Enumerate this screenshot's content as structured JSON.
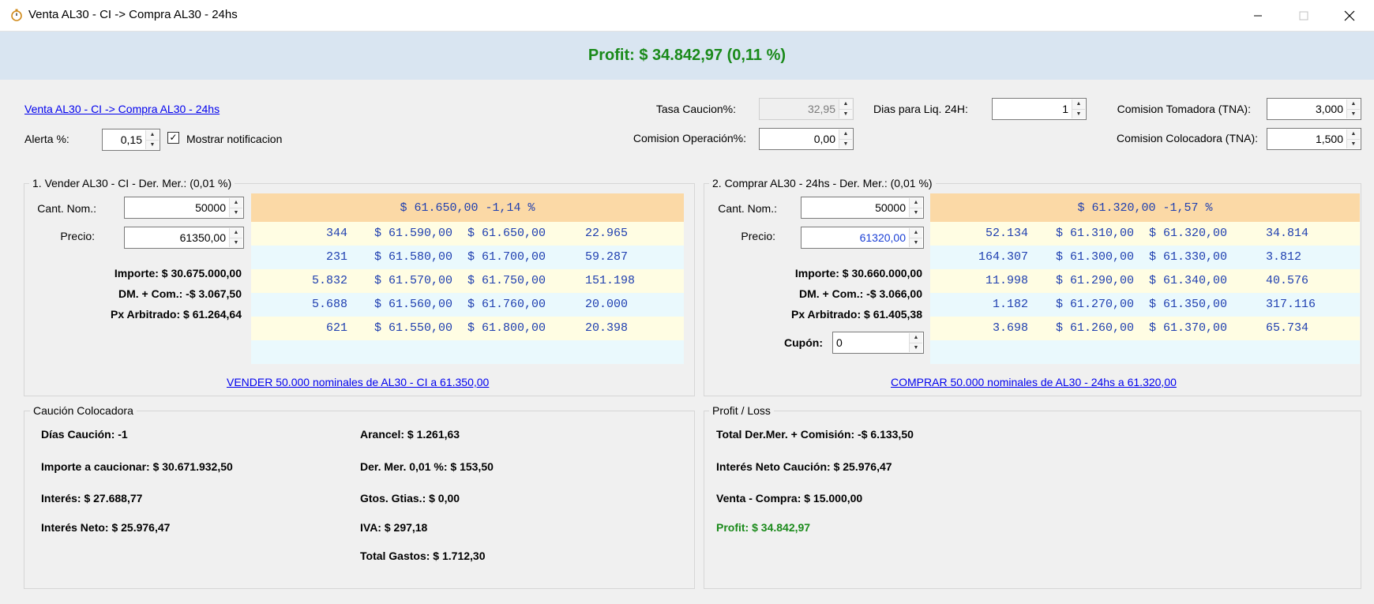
{
  "window": {
    "title": "Venta AL30 - CI -> Compra AL30 - 24hs",
    "icon": "stopwatch-icon",
    "controls": [
      "minimize-icon",
      "maximize-icon",
      "close-icon"
    ]
  },
  "banner": {
    "profit_text": "Profit: $ 34.842,97 (0,11 %)",
    "color": "#1a8a1a"
  },
  "top": {
    "strategy_link": "Venta AL30 - CI -> Compra AL30 - 24hs",
    "alerta_label": "Alerta %:",
    "alerta_value": "0,15",
    "notif_label": "Mostrar notificacion",
    "notif_checked": "✓",
    "tasa_caucion_label": "Tasa Caucion%:",
    "tasa_caucion_value": "32,95",
    "comision_operacion_label": "Comision Operación%:",
    "comision_operacion_value": "0,00",
    "dias_liq_label": "Dias para Liq. 24H:",
    "dias_liq_value": "1",
    "comision_tomadora_label": "Comision Tomadora (TNA):",
    "comision_tomadora_value": "3,000",
    "comision_colocadora_label": "Comision Colocadora (TNA):",
    "comision_colocadora_value": "1,500"
  },
  "sell": {
    "title": "1. Vender AL30 - CI - Der. Mer.: (0,01 %)",
    "cant_label": "Cant. Nom.:",
    "cant_value": "50000",
    "precio_label": "Precio:",
    "precio_value": "61350,00",
    "importe": "Importe: $ 30.675.000,00",
    "dm_com": "DM. + Com.: -$ 3.067,50",
    "px_arb": "Px Arbitrado: $ 61.264,64",
    "action_link": "VENDER 50.000 nominales de AL30 - CI a 61.350,00",
    "book_header": "$ 61.650,00 -1,14 %",
    "book": [
      [
        "344",
        "$ 61.590,00",
        "$ 61.650,00",
        "22.965"
      ],
      [
        "231",
        "$ 61.580,00",
        "$ 61.700,00",
        "59.287"
      ],
      [
        "5.832",
        "$ 61.570,00",
        "$ 61.750,00",
        "151.198"
      ],
      [
        "5.688",
        "$ 61.560,00",
        "$ 61.760,00",
        "20.000"
      ],
      [
        "621",
        "$ 61.550,00",
        "$ 61.800,00",
        "20.398"
      ]
    ]
  },
  "buy": {
    "title": "2. Comprar AL30 - 24hs - Der. Mer.: (0,01 %)",
    "cant_label": "Cant. Nom.:",
    "cant_value": "50000",
    "precio_label": "Precio:",
    "precio_value": "61320,00",
    "importe": "Importe: $ 30.660.000,00",
    "dm_com": "DM. + Com.: -$ 3.066,00",
    "px_arb": "Px Arbitrado: $ 61.405,38",
    "cupon_label": "Cupón:",
    "cupon_value": "0",
    "action_link": "COMPRAR 50.000 nominales de AL30 - 24hs a 61.320,00",
    "book_header": "$ 61.320,00 -1,57 %",
    "book": [
      [
        "52.134",
        "$ 61.310,00",
        "$ 61.320,00",
        "34.814"
      ],
      [
        "164.307",
        "$ 61.300,00",
        "$ 61.330,00",
        "3.812"
      ],
      [
        "11.998",
        "$ 61.290,00",
        "$ 61.340,00",
        "40.576"
      ],
      [
        "1.182",
        "$ 61.270,00",
        "$ 61.350,00",
        "317.116"
      ],
      [
        "3.698",
        "$ 61.260,00",
        "$ 61.370,00",
        "65.734"
      ]
    ]
  },
  "caucion": {
    "title": "Caución Colocadora",
    "dias": "Días Caución: -1",
    "importe": "Importe a caucionar: $ 30.671.932,50",
    "interes": "Interés: $ 27.688,77",
    "interes_neto": "Interés Neto: $ 25.976,47",
    "arancel": "Arancel: $ 1.261,63",
    "der_mer": "Der. Mer. 0,01 %: $ 153,50",
    "gtos": "Gtos. Gtias.: $ 0,00",
    "iva": "IVA: $ 297,18",
    "total_gastos": "Total Gastos: $ 1.712,30"
  },
  "pl": {
    "title": "Profit / Loss",
    "total_der": "Total Der.Mer. + Comisión: -$ 6.133,50",
    "interes_neto": "Interés Neto Caución: $ 25.976,47",
    "venta_compra": "Venta - Compra: $ 15.000,00",
    "profit": "Profit: $ 34.842,97"
  }
}
